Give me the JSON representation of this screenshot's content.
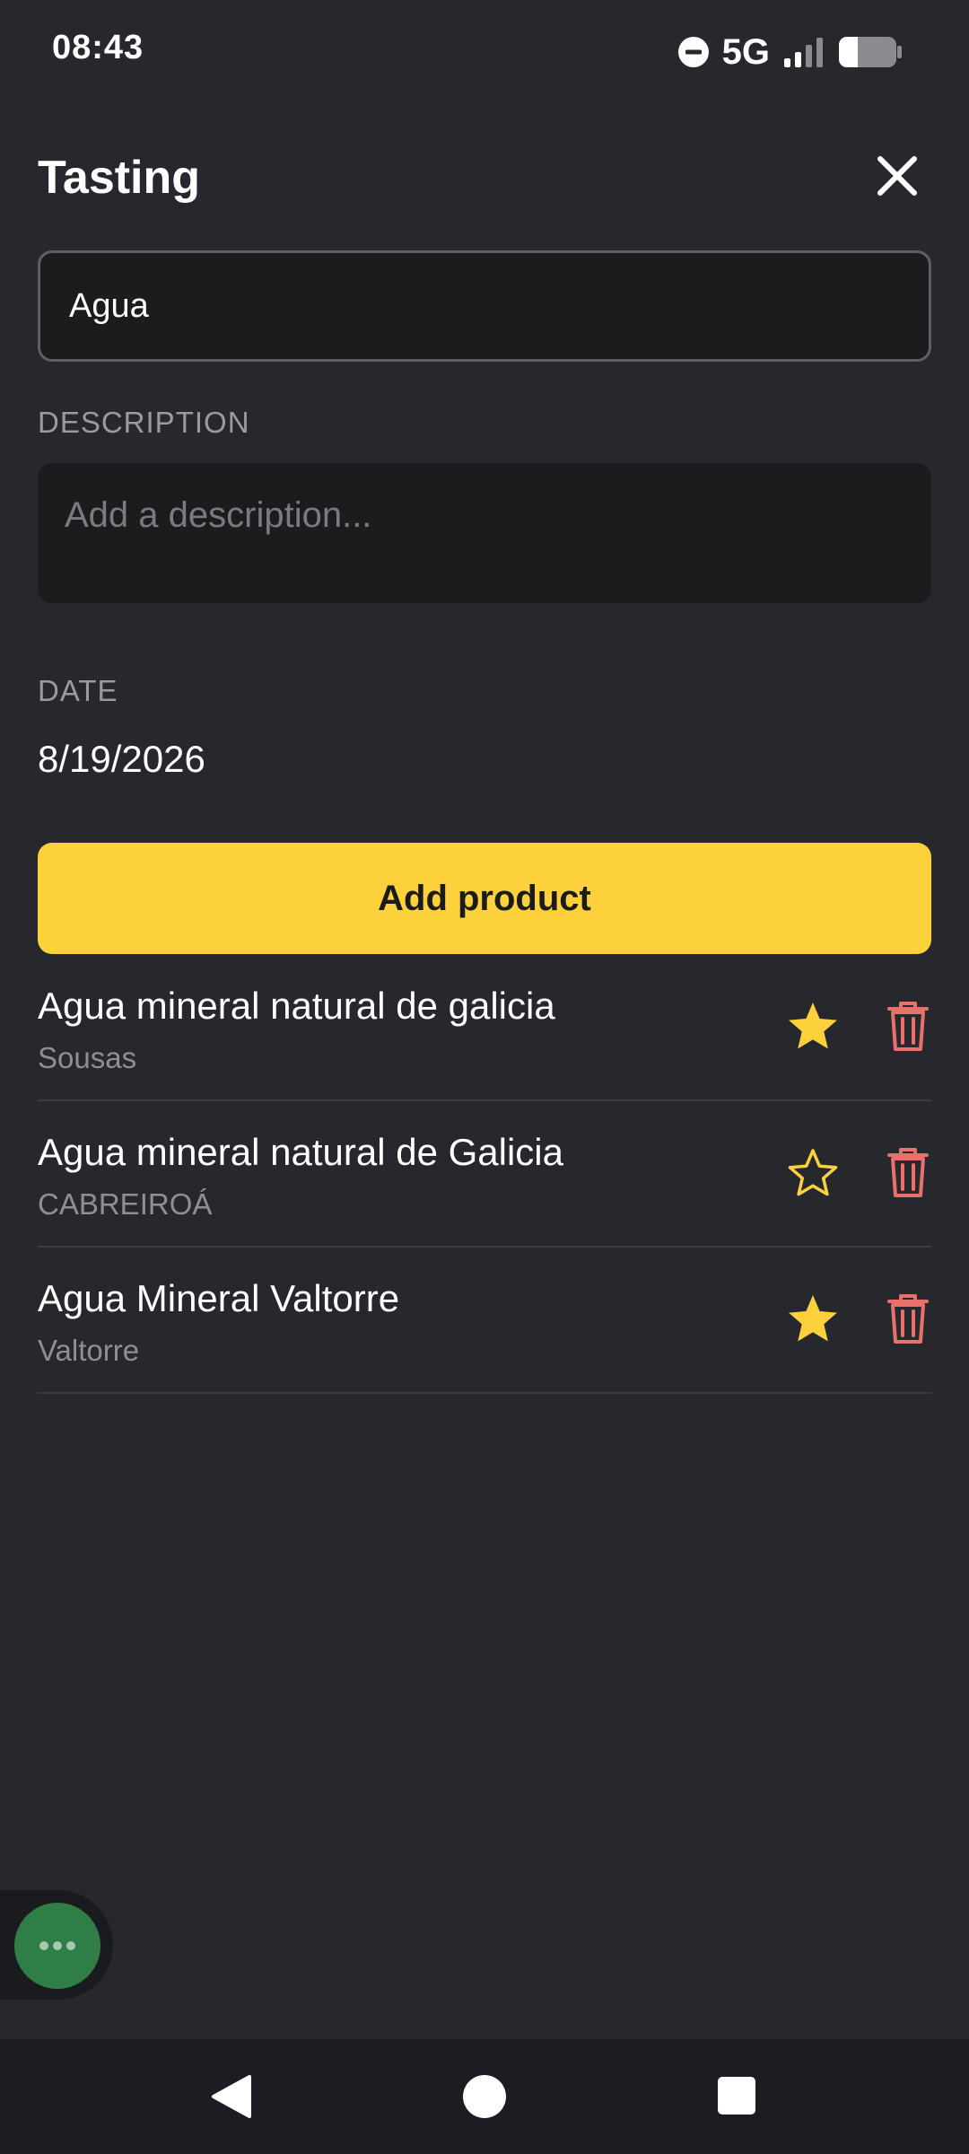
{
  "status_bar": {
    "time": "08:43",
    "network": "5G",
    "icons": [
      "do-not-disturb-icon",
      "signal-icon",
      "battery-icon"
    ]
  },
  "header": {
    "title": "Tasting",
    "close_icon": "close-icon"
  },
  "form": {
    "name_value": "Agua",
    "description_label": "DESCRIPTION",
    "description_placeholder": "Add a description...",
    "date_label": "DATE",
    "date_value": "8/19/2026",
    "add_product_label": "Add product"
  },
  "products": [
    {
      "name": "Agua mineral natural de galicia",
      "brand": "Sousas",
      "favorite": true
    },
    {
      "name": "Agua mineral natural de Galicia",
      "brand": "CABREIROÁ",
      "favorite": false
    },
    {
      "name": "Agua Mineral Valtorre",
      "brand": "Valtorre",
      "favorite": true
    }
  ],
  "colors": {
    "background": "#26282e",
    "accent": "#fdd13c",
    "star": "#fdd13c",
    "delete": "#e8716c",
    "fab": "#2f7d47"
  },
  "fab": {
    "icon": "more-horizontal-icon"
  },
  "nav": {
    "icons": [
      "back-icon",
      "home-icon",
      "recents-icon"
    ]
  }
}
